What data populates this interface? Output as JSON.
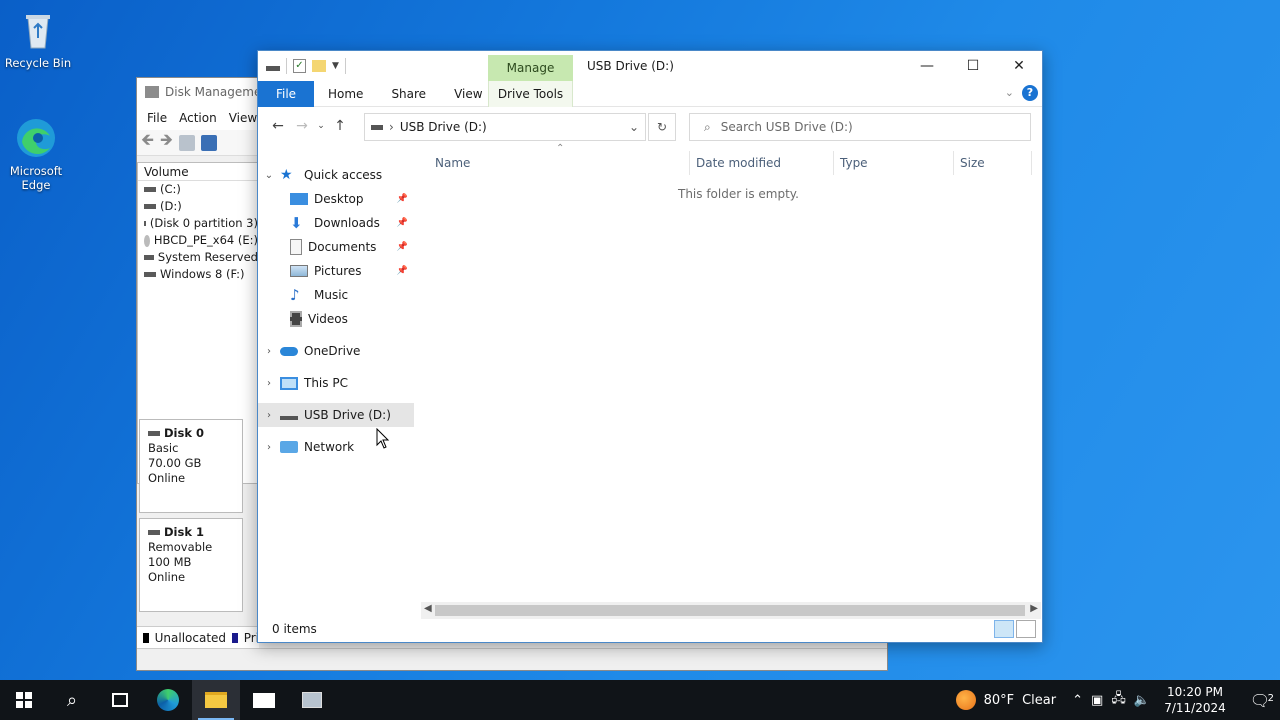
{
  "desktop": {
    "icons": [
      {
        "label": "Recycle Bin",
        "icon": "recycle-bin-icon"
      },
      {
        "label": "Microsoft Edge",
        "icon": "edge-icon"
      }
    ]
  },
  "disk_management": {
    "title": "Disk Management",
    "menu": [
      "File",
      "Action",
      "View"
    ],
    "volume_header": "Volume",
    "volumes": [
      "(C:)",
      "(D:)",
      "(Disk 0 partition 3)",
      "HBCD_PE_x64 (E:)",
      "System Reserved",
      "Windows 8 (F:)"
    ],
    "disks": [
      {
        "name": "Disk 0",
        "type": "Basic",
        "size": "70.00 GB",
        "status": "Online"
      },
      {
        "name": "Disk 1",
        "type": "Removable",
        "size": "100 MB",
        "status": "Online"
      }
    ],
    "legend": [
      "Unallocated",
      "Pri"
    ]
  },
  "explorer": {
    "title": "USB Drive (D:)",
    "contextual_tab": "Manage",
    "ribbon_tabs": [
      "File",
      "Home",
      "Share",
      "View"
    ],
    "contextual_group": "Drive Tools",
    "address": "USB Drive (D:)",
    "search_placeholder": "Search USB Drive (D:)",
    "columns": [
      "Name",
      "Date modified",
      "Type",
      "Size"
    ],
    "empty_message": "This folder is empty.",
    "status": "0 items",
    "nav": {
      "quick_access": "Quick access",
      "quick_items": [
        {
          "label": "Desktop",
          "icon": "desktop-folder-icon"
        },
        {
          "label": "Downloads",
          "icon": "downloads-folder-icon"
        },
        {
          "label": "Documents",
          "icon": "documents-folder-icon"
        },
        {
          "label": "Pictures",
          "icon": "pictures-folder-icon"
        },
        {
          "label": "Music",
          "icon": "music-folder-icon"
        },
        {
          "label": "Videos",
          "icon": "videos-folder-icon"
        }
      ],
      "onedrive": "OneDrive",
      "this_pc": "This PC",
      "usb": "USB Drive (D:)",
      "network": "Network"
    }
  },
  "taskbar": {
    "weather_temp": "80°F",
    "weather_desc": "Clear",
    "time": "10:20 PM",
    "date": "7/11/2024",
    "notification_count": "2",
    "colors": {
      "accent": "#1a73d2",
      "manage_tab": "#c7e8b0",
      "taskbar": "#101418"
    }
  }
}
